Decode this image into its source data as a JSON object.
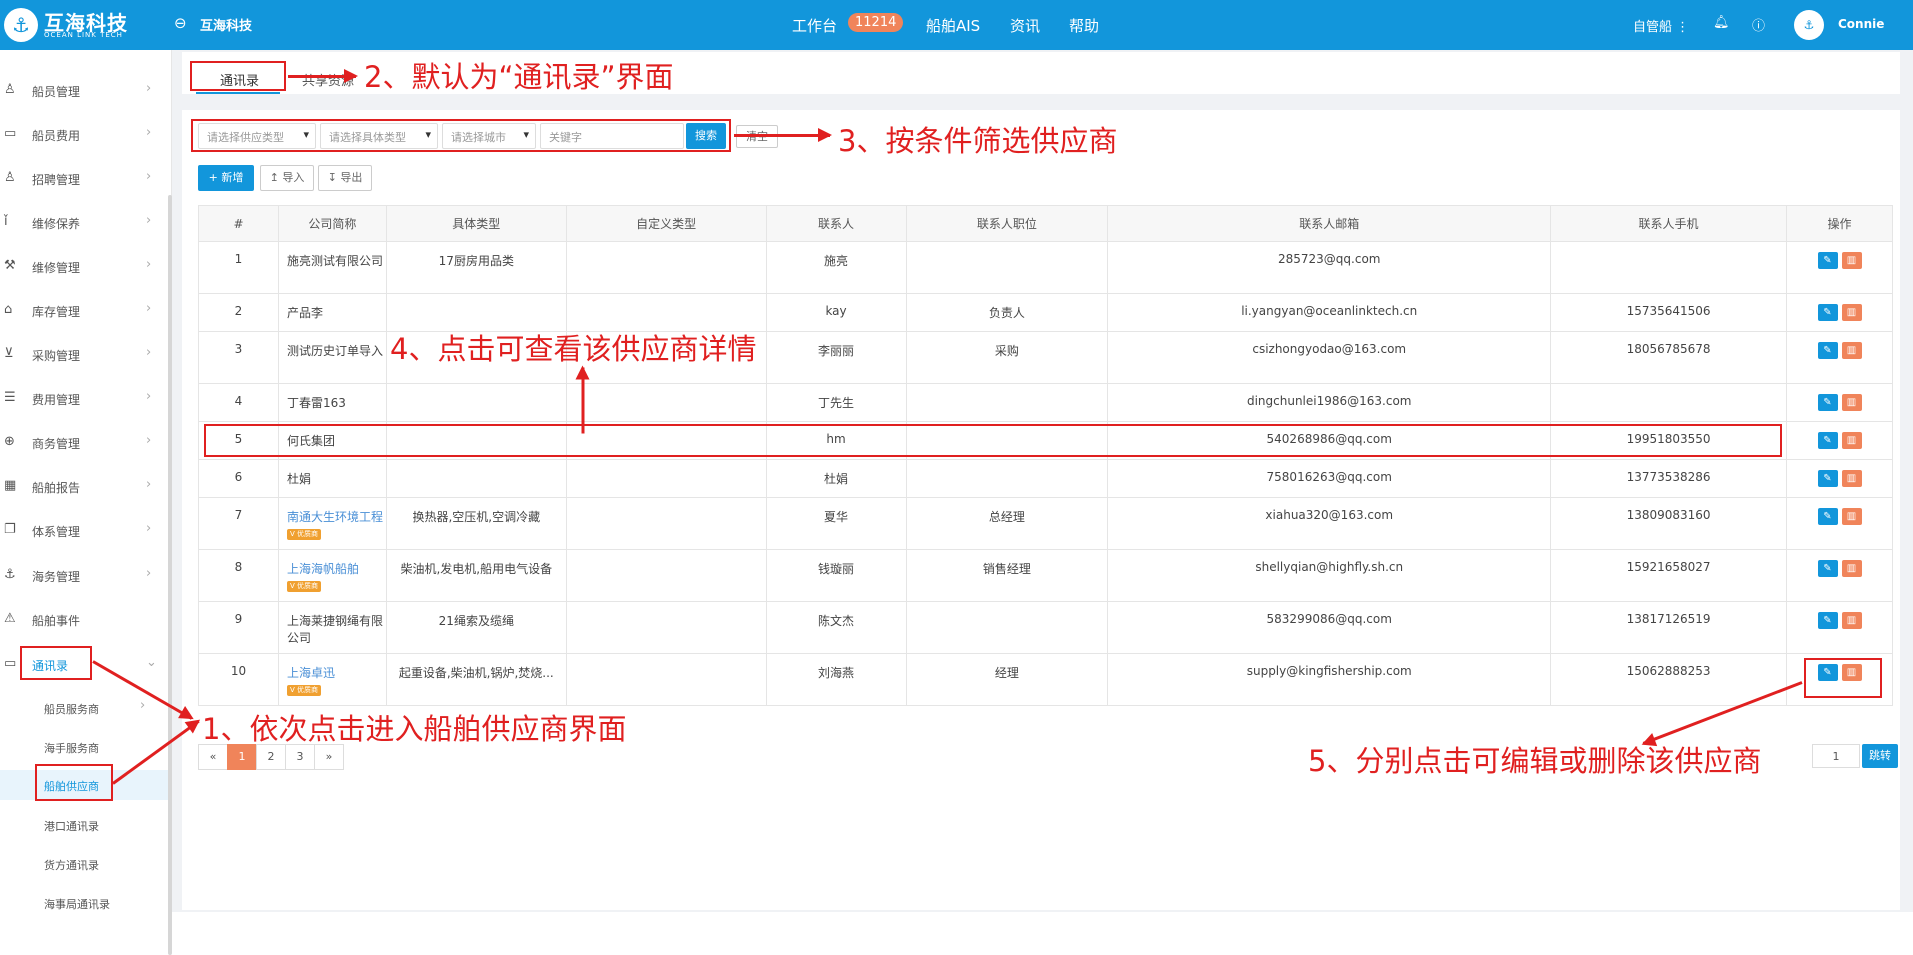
{
  "header": {
    "logo_text": "互海科技",
    "logo_sub": "OCEAN LINK TECH",
    "back_title": "互海科技",
    "nav": [
      {
        "label": "工作台"
      },
      {
        "label": "船舶AIS"
      },
      {
        "label": "资讯"
      },
      {
        "label": "帮助"
      }
    ],
    "workbench_badge": "11214",
    "ship_label": "自管船",
    "username": "Connie"
  },
  "sidebar": {
    "items": [
      {
        "label": "船员管理",
        "icon": "user-icon"
      },
      {
        "label": "船员费用",
        "icon": "wallet-icon"
      },
      {
        "label": "招聘管理",
        "icon": "user-icon"
      },
      {
        "label": "维修保养",
        "icon": "thermometer-icon"
      },
      {
        "label": "维修管理",
        "icon": "wrench-icon"
      },
      {
        "label": "库存管理",
        "icon": "home-icon"
      },
      {
        "label": "采购管理",
        "icon": "cart-icon"
      },
      {
        "label": "费用管理",
        "icon": "database-icon"
      },
      {
        "label": "商务管理",
        "icon": "globe-icon"
      },
      {
        "label": "船舶报告",
        "icon": "calendar-icon"
      },
      {
        "label": "体系管理",
        "icon": "copy-icon"
      },
      {
        "label": "海务管理",
        "icon": "anchor-icon"
      },
      {
        "label": "船舶事件",
        "icon": "warning-icon"
      },
      {
        "label": "通讯录",
        "icon": "contact-icon"
      }
    ],
    "sub_items": [
      {
        "label": "船员服务商"
      },
      {
        "label": "海手服务商"
      },
      {
        "label": "船舶供应商"
      },
      {
        "label": "港口通讯录"
      },
      {
        "label": "货方通讯录"
      },
      {
        "label": "海事局通讯录"
      }
    ]
  },
  "tabs": [
    {
      "label": "通讯录"
    },
    {
      "label": "共享资源"
    }
  ],
  "filters": {
    "supplier_type": "请选择供应类型",
    "specific_type": "请选择具体类型",
    "city": "请选择城市",
    "keyword_placeholder": "关键字",
    "search_label": "搜索",
    "clear_label": "清空"
  },
  "toolbar": {
    "add_label": "+ 新增",
    "import_label": "导入",
    "export_label": "导出"
  },
  "table": {
    "columns": [
      "#",
      "公司简称",
      "具体类型",
      "自定义类型",
      "联系人",
      "联系人职位",
      "联系人邮箱",
      "联系人手机",
      "操作"
    ],
    "rows": [
      {
        "no": "1",
        "company": "施亮测试有限公司",
        "type": "17厨房用品类",
        "custom": "",
        "contact": "施亮",
        "position": "",
        "email": "285723@qq.com",
        "phone": "",
        "link": false,
        "tag": ""
      },
      {
        "no": "2",
        "company": "产品李",
        "type": "",
        "custom": "",
        "contact": "kay",
        "position": "负责人",
        "email": "li.yangyan@oceanlinktech.cn",
        "phone": "15735641506",
        "link": false,
        "tag": ""
      },
      {
        "no": "3",
        "company": "测试历史订单导入",
        "type": "",
        "custom": "",
        "contact": "李丽丽",
        "position": "采购",
        "email": "csizhongyodao@163.com",
        "phone": "18056785678",
        "link": false,
        "tag": ""
      },
      {
        "no": "4",
        "company": "丁春雷163",
        "type": "",
        "custom": "",
        "contact": "丁先生",
        "position": "",
        "email": "dingchunlei1986@163.com",
        "phone": "",
        "link": false,
        "tag": ""
      },
      {
        "no": "5",
        "company": "何氏集团",
        "type": "",
        "custom": "",
        "contact": "hm",
        "position": "",
        "email": "540268986@qq.com",
        "phone": "19951803550",
        "link": false,
        "tag": ""
      },
      {
        "no": "6",
        "company": "杜娟",
        "type": "",
        "custom": "",
        "contact": "杜娟",
        "position": "",
        "email": "758016263@qq.com",
        "phone": "13773538286",
        "link": false,
        "tag": ""
      },
      {
        "no": "7",
        "company": "南通大生环境工程",
        "type": "换热器,空压机,空调冷藏",
        "custom": "",
        "contact": "夏华",
        "position": "总经理",
        "email": "xiahua320@163.com",
        "phone": "13809083160",
        "link": true,
        "tag": "V 优质商"
      },
      {
        "no": "8",
        "company": "上海海帆船舶",
        "type": "柴油机,发电机,船用电气设备",
        "custom": "",
        "contact": "钱璇丽",
        "position": "销售经理",
        "email": "shellyqian@highfly.sh.cn",
        "phone": "15921658027",
        "link": true,
        "tag": "V 优质商"
      },
      {
        "no": "9",
        "company": "上海莱捷钢绳有限公司",
        "type": "21绳索及缆绳",
        "custom": "",
        "contact": "陈文杰",
        "position": "",
        "email": "583299086@qq.com",
        "phone": "13817126519",
        "link": false,
        "tag": ""
      },
      {
        "no": "10",
        "company": "上海卓迅",
        "type": "起重设备,柴油机,锅炉,焚烧...",
        "custom": "",
        "contact": "刘海燕",
        "position": "经理",
        "email": "supply@kingfishership.com",
        "phone": "15062888253",
        "link": true,
        "tag": "V 优质商"
      }
    ]
  },
  "pagination": {
    "prev": "«",
    "pages": [
      "1",
      "2",
      "3"
    ],
    "next": "»",
    "current": "1",
    "jump_value": "1",
    "jump_label": "跳转"
  },
  "annotations": {
    "a1": "1、依次点击进入船舶供应商界面",
    "a2": "2、默认为“通讯录”界面",
    "a3": "3、按条件筛选供应商",
    "a4": "4、点击可查看该供应商详情",
    "a5": "5、分别点击可编辑或删除该供应商"
  },
  "colors": {
    "header_bg": "#1296db",
    "annotation_red": "#e02020",
    "delete_btn": "#f0845a",
    "badge": "#f0845a"
  }
}
